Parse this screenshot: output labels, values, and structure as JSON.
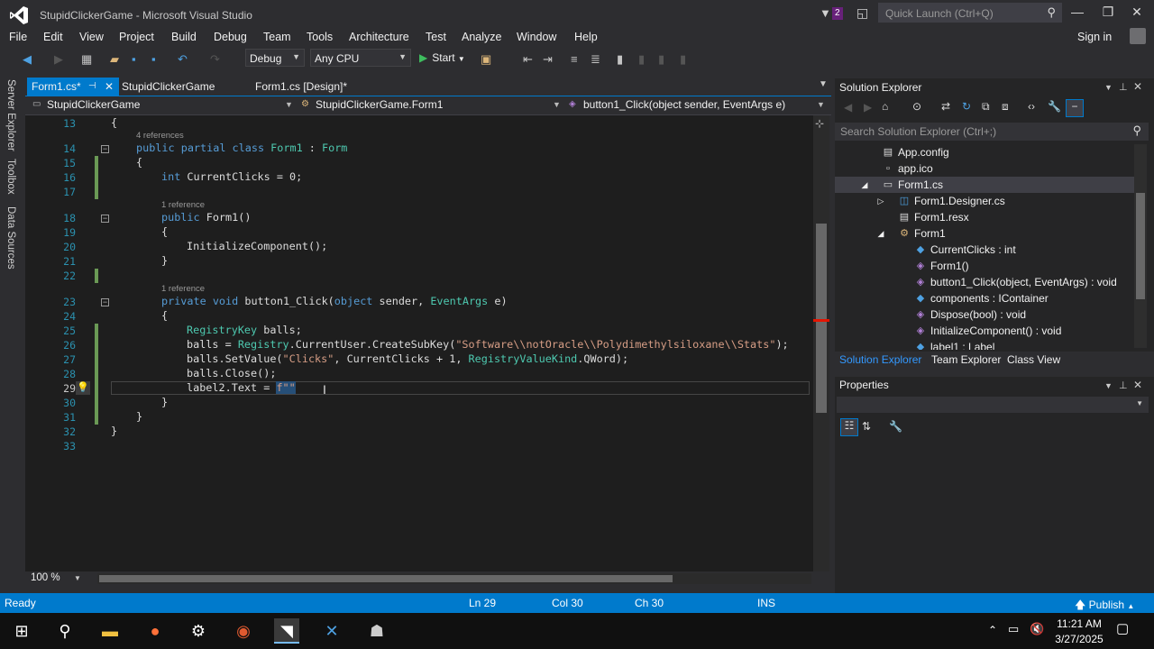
{
  "window": {
    "title": "StupidClickerGame - Microsoft Visual Studio",
    "notification_count": "2",
    "quick_launch_placeholder": "Quick Launch (Ctrl+Q)"
  },
  "menu": [
    "File",
    "Edit",
    "View",
    "Project",
    "Build",
    "Debug",
    "Team",
    "Tools",
    "Architecture",
    "Test",
    "Analyze",
    "Window",
    "Help"
  ],
  "account": {
    "sign_in": "Sign in"
  },
  "toolbar": {
    "configuration": "Debug",
    "platform": "Any CPU",
    "start_label": "Start"
  },
  "side_tabs": [
    "Server Explorer",
    "Toolbox",
    "Data Sources"
  ],
  "doc_tabs": [
    {
      "label": "Form1.cs*",
      "active": true
    },
    {
      "label": "StupidClickerGame",
      "active": false
    },
    {
      "label": "Form1.cs [Design]*",
      "active": false
    }
  ],
  "navbar": {
    "project": "StupidClickerGame",
    "type": "StupidClickerGame.Form1",
    "member": "button1_Click(object sender, EventArgs e)"
  },
  "code": {
    "references": [
      "4 references",
      "1 reference",
      "1 reference"
    ],
    "line_numbers": [
      "13",
      "14",
      "15",
      "16",
      "17",
      "18",
      "19",
      "20",
      "21",
      "22",
      "23",
      "24",
      "25",
      "26",
      "27",
      "28",
      "29",
      "30",
      "31",
      "32",
      "33"
    ],
    "lines": {
      "l13": "{",
      "l14a": "public partial class ",
      "l14b": "Form1",
      "l14c": " : ",
      "l14d": "Form",
      "l15": "{",
      "l16a": "int",
      "l16b": " CurrentClicks = 0;",
      "l18a": "public",
      "l18b": " Form1()",
      "l19": "{",
      "l20": "InitializeComponent();",
      "l21": "}",
      "l23a": "private void",
      "l23b": " button1_Click(",
      "l23c": "object",
      "l23d": " sender, ",
      "l23e": "EventArgs",
      "l23f": " e)",
      "l24": "{",
      "l25a": "RegistryKey",
      "l25b": " balls;",
      "l26a": "balls = ",
      "l26b": "Registry",
      "l26c": ".CurrentUser.CreateSubKey(",
      "l26d": "\"Software\\\\notOracle\\\\Polydimethylsiloxane\\\\Stats\"",
      "l26e": ");",
      "l27a": "balls.SetValue(",
      "l27b": "\"Clicks\"",
      "l27c": ", CurrentClicks + 1, ",
      "l27d": "RegistryValueKind",
      "l27e": ".QWord);",
      "l28": "balls.Close();",
      "l29a": "label2.Text = ",
      "l29b": "f\"\"",
      "l30": "}",
      "l31": "}",
      "l32": "}"
    }
  },
  "zoom": "100 %",
  "solution_explorer": {
    "title": "Solution Explorer",
    "search_placeholder": "Search Solution Explorer (Ctrl+;)",
    "items": [
      "App.config",
      "app.ico",
      "Form1.cs",
      "Form1.Designer.cs",
      "Form1.resx",
      "Form1",
      "CurrentClicks : int",
      "Form1()",
      "button1_Click(object, EventArgs) : void",
      "components : IContainer",
      "Dispose(bool) : void",
      "InitializeComponent() : void",
      "label1 : Label"
    ],
    "tabs": [
      "Solution Explorer",
      "Team Explorer",
      "Class View"
    ]
  },
  "properties": {
    "title": "Properties"
  },
  "status": {
    "state": "Ready",
    "line": "Ln 29",
    "col": "Col 30",
    "ch": "Ch 30",
    "mode": "INS",
    "publish": "Publish"
  },
  "taskbar": {
    "time": "11:21 AM",
    "date": "3/27/2025"
  },
  "colors": {
    "accent": "#007acc",
    "keyword": "#569cd6",
    "type": "#4ec9b0",
    "string": "#d69d85",
    "line_number": "#2b91af"
  }
}
